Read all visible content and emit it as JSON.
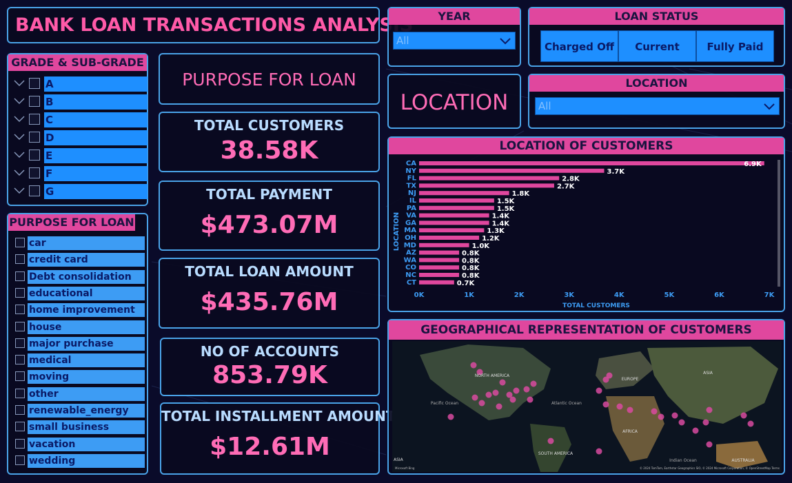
{
  "title": "BANK LOAN TRANSACTIONS ANALYSIS",
  "year_filter": {
    "header": "YEAR",
    "value": "All"
  },
  "loan_status": {
    "header": "LOAN STATUS",
    "options": [
      "Charged Off",
      "Current",
      "Fully Paid"
    ]
  },
  "location_filter": {
    "header": "LOCATION",
    "value": "All"
  },
  "grade_panel": {
    "header": "GRADE & SUB-GRADE",
    "items": [
      "A",
      "B",
      "C",
      "D",
      "E",
      "F",
      "G"
    ]
  },
  "purpose_panel": {
    "header": "PURPOSE FOR LOAN",
    "items": [
      "car",
      "credit card",
      "Debt consolidation",
      "educational",
      "home improvement",
      "house",
      "major purchase",
      "medical",
      "moving",
      "other",
      "renewable_energy",
      "small business",
      "vacation",
      "wedding"
    ]
  },
  "purpose_title": "PURPOSE FOR LOAN",
  "location_title": "LOCATION",
  "kpis": {
    "customers": {
      "label": "TOTAL CUSTOMERS",
      "value": "38.58K"
    },
    "payment": {
      "label": "TOTAL PAYMENT",
      "value": "$473.07M"
    },
    "loan_amount": {
      "label": "TOTAL LOAN AMOUNT",
      "value": "$435.76M"
    },
    "accounts": {
      "label": "NO OF ACCOUNTS",
      "value": "853.79K"
    },
    "installment": {
      "label": "TOTAL INSTALLMENT AMOUNT",
      "value": "$12.61M"
    }
  },
  "location_chart_header": "LOCATION OF CUSTOMERS",
  "map_header": "GEOGRAPHICAL REPRESENTATION OF CUSTOMERS",
  "map_labels": {
    "north_america": "NORTH AMERICA",
    "europe": "EUROPE",
    "asia": "ASIA",
    "africa": "AFRICA",
    "south_america": "SOUTH AMERICA",
    "australia": "AUSTRALIA",
    "pacific": "Pacific Ocean",
    "atlantic": "Atlantic Ocean",
    "indian": "Indian Ocean",
    "asia_left": "ASIA",
    "attribution": "© 2024 TomTom, Earthstar Geographics SIO, © 2024 Microsoft Corporation, © OpenStreetMap  Terms",
    "brand": "Microsoft Bing"
  },
  "colors": {
    "accent_pink": "#e0479e",
    "panel_border": "#4aa3e8",
    "slicer_blue": "#1e8fff",
    "background": "#0a0b2a"
  },
  "chart_data": {
    "type": "bar",
    "orientation": "horizontal",
    "title": "LOCATION OF CUSTOMERS",
    "ylabel": "LOCATION",
    "xlabel": "TOTAL CUSTOMERS",
    "categories": [
      "CA",
      "NY",
      "FL",
      "TX",
      "NJ",
      "IL",
      "PA",
      "VA",
      "GA",
      "MA",
      "OH",
      "MD",
      "AZ",
      "WA",
      "CO",
      "NC",
      "CT"
    ],
    "values": [
      6900,
      3700,
      2800,
      2700,
      1800,
      1500,
      1500,
      1400,
      1400,
      1300,
      1200,
      1000,
      800,
      800,
      800,
      800,
      700
    ],
    "data_labels": [
      "6.9K",
      "3.7K",
      "2.8K",
      "2.7K",
      "1.8K",
      "1.5K",
      "1.5K",
      "1.4K",
      "1.4K",
      "1.3K",
      "1.2K",
      "1.0K",
      "0.8K",
      "0.8K",
      "0.8K",
      "0.8K",
      "0.7K"
    ],
    "xlim": [
      0,
      7000
    ],
    "xticks": [
      "0K",
      "1K",
      "2K",
      "3K",
      "4K",
      "5K",
      "6K",
      "7K"
    ],
    "bar_color": "#e0479e",
    "grid": false
  }
}
